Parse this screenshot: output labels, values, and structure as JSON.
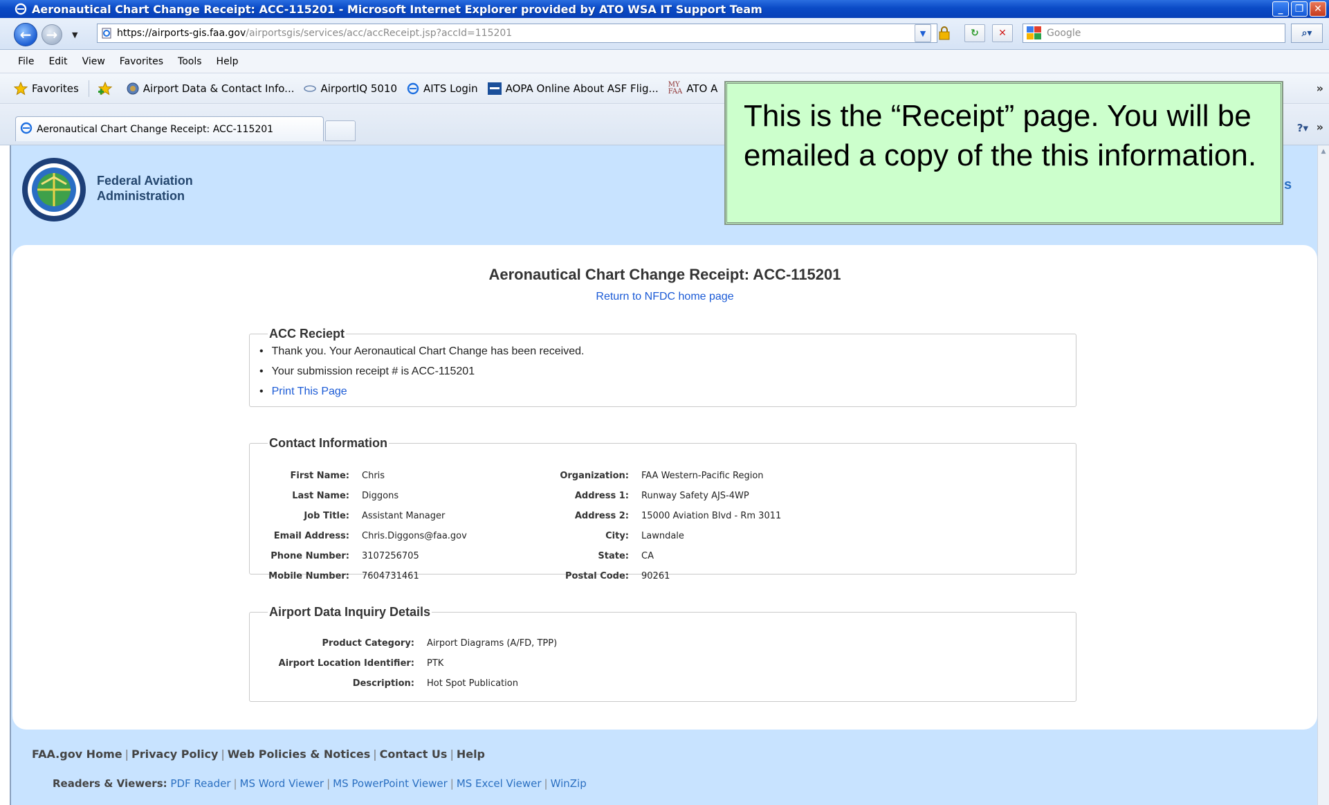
{
  "window": {
    "title": "Aeronautical Chart Change Receipt: ACC-115201 - Microsoft Internet Explorer provided by ATO WSA IT Support Team"
  },
  "address_bar": {
    "url_domain": "https://airports-gis.faa.gov",
    "url_path": "/airportsgis/services/acc/accReceipt.jsp?accId=115201",
    "search_placeholder": "Google"
  },
  "menu": [
    "File",
    "Edit",
    "View",
    "Favorites",
    "Tools",
    "Help"
  ],
  "favorites": {
    "label": "Favorites",
    "items": [
      "Airport Data & Contact Info...",
      "AirportIQ 5010",
      "AITS Login",
      "AOPA Online About ASF Flig...",
      "ATO A"
    ]
  },
  "tab": {
    "label": "Aeronautical Chart Change Receipt: ACC-115201"
  },
  "header": {
    "agency_line1": "Federal Aviation",
    "agency_line2": "Administration",
    "right_fragment": "s"
  },
  "receipt": {
    "title": "Aeronautical Chart Change Receipt: ACC-115201",
    "home_link": "Return to NFDC home page"
  },
  "acc_receipt": {
    "legend": "ACC Reciept",
    "items": [
      "Thank you. Your Aeronautical Chart Change has been received.",
      "Your submission receipt # is ACC-115201"
    ],
    "print_link": "Print This Page"
  },
  "contact": {
    "legend": "Contact Information",
    "left": [
      {
        "label": "First Name:",
        "value": "Chris"
      },
      {
        "label": "Last Name:",
        "value": "Diggons"
      },
      {
        "label": "Job Title:",
        "value": "Assistant Manager"
      },
      {
        "label": "Email Address:",
        "value": "Chris.Diggons@faa.gov"
      },
      {
        "label": "Phone Number:",
        "value": "3107256705"
      },
      {
        "label": "Mobile Number:",
        "value": "7604731461"
      }
    ],
    "right": [
      {
        "label": "Organization:",
        "value": "FAA Western-Pacific Region"
      },
      {
        "label": "Address 1:",
        "value": "Runway Safety AJS-4WP"
      },
      {
        "label": "Address 2:",
        "value": "15000 Aviation Blvd - Rm 3011"
      },
      {
        "label": "City:",
        "value": "Lawndale"
      },
      {
        "label": "State:",
        "value": "CA"
      },
      {
        "label": "Postal Code:",
        "value": "90261"
      }
    ]
  },
  "inquiry": {
    "legend": "Airport Data Inquiry Details",
    "rows": [
      {
        "label": "Product Category:",
        "value": "Airport Diagrams (A/FD, TPP)"
      },
      {
        "label": "Airport Location Identifier:",
        "value": "PTK"
      },
      {
        "label": "Description:",
        "value": "Hot Spot Publication"
      }
    ]
  },
  "footer": {
    "links": [
      "FAA.gov Home",
      "Privacy Policy",
      "Web Policies & Notices",
      "Contact Us",
      "Help"
    ],
    "viewers_label": "Readers & Viewers:",
    "viewers": [
      "PDF Reader",
      "MS Word Viewer",
      "MS PowerPoint Viewer",
      "MS Excel Viewer",
      "WinZip"
    ]
  },
  "callout": {
    "text": "This is the “Receipt” page.  You will be emailed a copy of the this information."
  },
  "colors": {
    "page_background": "#c8e3ff",
    "link": "#1a5ad6",
    "callout_background": "#ccffcc",
    "titlebar": "#0a4ac6"
  }
}
